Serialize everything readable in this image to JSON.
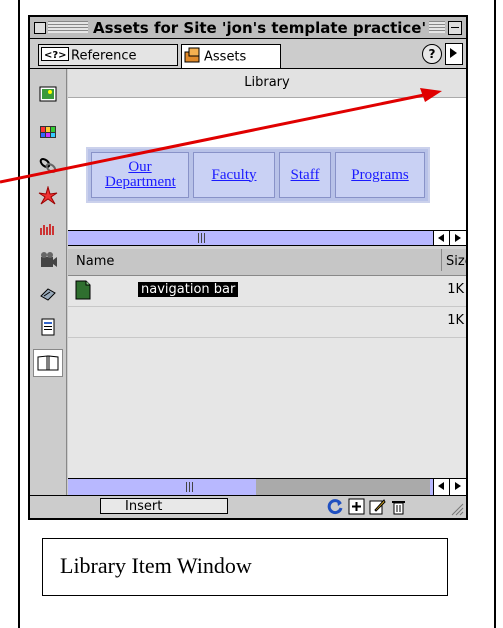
{
  "window": {
    "title": "Assets for Site 'jon's template practice'",
    "tabs": [
      {
        "label": "Reference",
        "icon": "reference-icon"
      },
      {
        "label": "Assets",
        "icon": "assets-icon",
        "active": true
      }
    ],
    "help_label": "?"
  },
  "sidebar": {
    "categories": [
      {
        "name": "images",
        "icon": "image-icon"
      },
      {
        "name": "colors",
        "icon": "color-swatch-icon"
      },
      {
        "name": "urls",
        "icon": "link-icon"
      },
      {
        "name": "flash",
        "icon": "flash-icon"
      },
      {
        "name": "shockwave",
        "icon": "shockwave-icon"
      },
      {
        "name": "movies",
        "icon": "movie-icon"
      },
      {
        "name": "scripts",
        "icon": "script-icon"
      },
      {
        "name": "templates",
        "icon": "template-icon"
      },
      {
        "name": "library",
        "icon": "library-book-icon",
        "active": true
      }
    ]
  },
  "library": {
    "heading": "Library",
    "preview_links": [
      "Our Department",
      "Faculty",
      "Staff",
      "Programs"
    ],
    "columns": {
      "name": "Name",
      "size": "Size"
    },
    "items": [
      {
        "name": "navigation bar",
        "size": "1K",
        "selected": true,
        "icon": "library-item-icon"
      },
      {
        "name": "",
        "size": "1K",
        "selected": false,
        "icon": ""
      }
    ]
  },
  "toolbar": {
    "insert_label": "Insert",
    "icons": [
      "refresh-icon",
      "new-item-icon",
      "edit-icon",
      "delete-icon"
    ]
  },
  "caption": "Library Item Window",
  "colors": {
    "annotation_arrow": "#e00000",
    "scrollbar": "#b8b8ff",
    "link": "#1a1aff"
  }
}
